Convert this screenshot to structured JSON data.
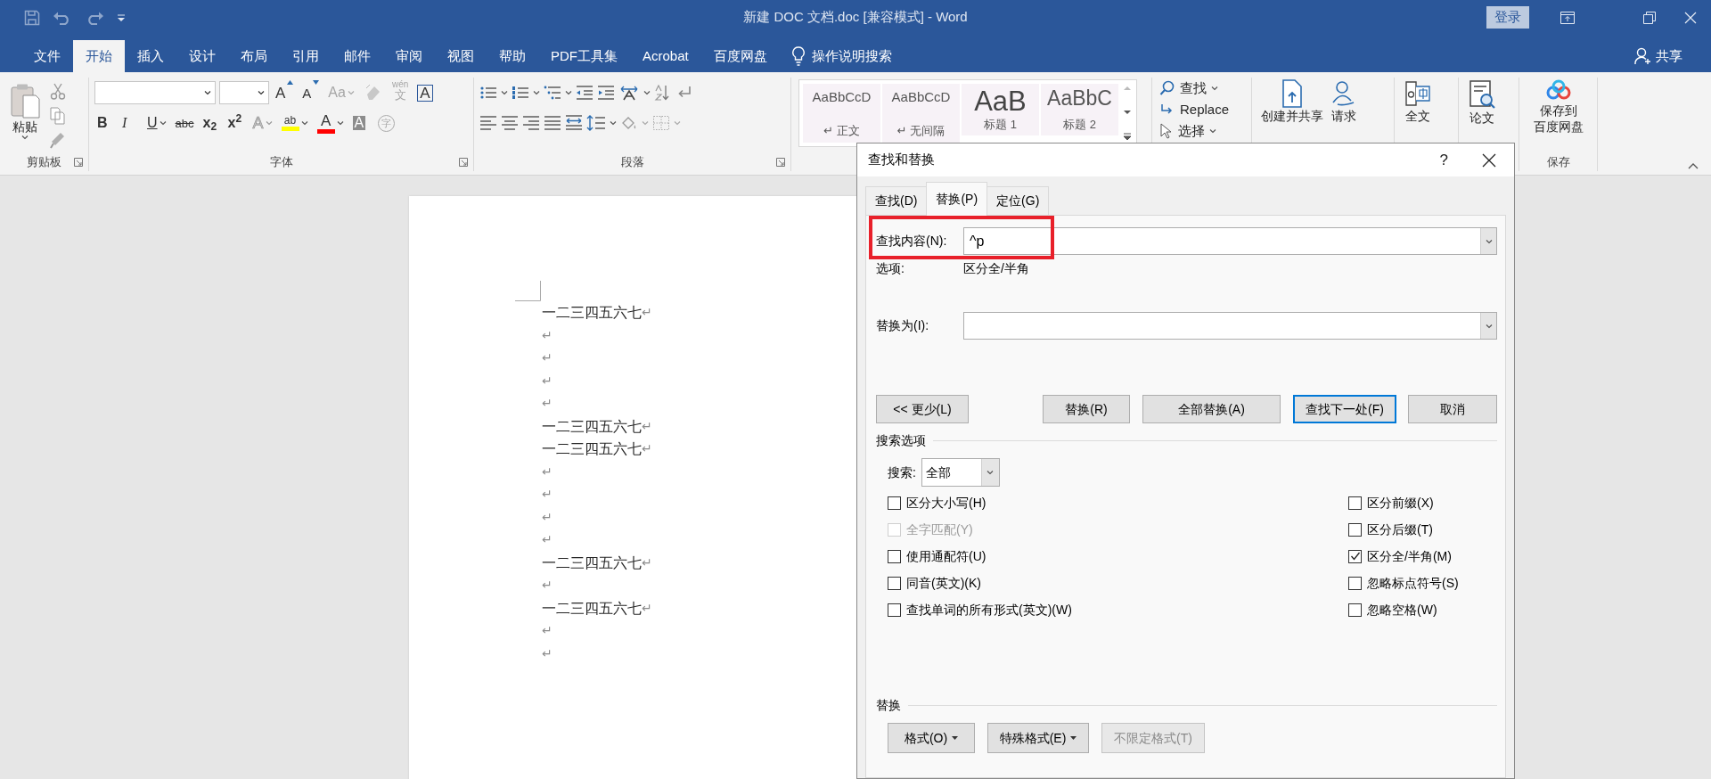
{
  "window": {
    "title": "新建 DOC 文档.doc [兼容模式]  -  Word",
    "sign_in": "登录"
  },
  "tabs": [
    {
      "label": "文件",
      "selected": false
    },
    {
      "label": "开始",
      "selected": true
    },
    {
      "label": "插入",
      "selected": false
    },
    {
      "label": "设计",
      "selected": false
    },
    {
      "label": "布局",
      "selected": false
    },
    {
      "label": "引用",
      "selected": false
    },
    {
      "label": "邮件",
      "selected": false
    },
    {
      "label": "审阅",
      "selected": false
    },
    {
      "label": "视图",
      "selected": false
    },
    {
      "label": "帮助",
      "selected": false
    },
    {
      "label": "PDF工具集",
      "selected": false
    },
    {
      "label": "Acrobat",
      "selected": false
    },
    {
      "label": "百度网盘",
      "selected": false
    }
  ],
  "tell_me": "操作说明搜索",
  "share": "共享",
  "ribbon": {
    "clipboard": {
      "paste": "粘贴",
      "label": "剪贴板"
    },
    "font": {
      "label": "字体",
      "tools_row1": [
        {
          "kind": "grow",
          "glyph": "A",
          "disabled": false
        },
        {
          "kind": "shrink",
          "glyph": "A",
          "disabled": false
        },
        {
          "kind": "case",
          "glyph": "Aa",
          "disabled": true
        },
        {
          "kind": "clear",
          "disabled": true
        },
        {
          "kind": "phonetic",
          "glyph": "文",
          "ruby": "wén",
          "disabled": true
        },
        {
          "kind": "border",
          "glyph": "A",
          "disabled": false
        }
      ],
      "tools_row2": [
        {
          "kind": "bold",
          "glyph": "B",
          "disabled": false
        },
        {
          "kind": "italic",
          "glyph": "I",
          "disabled": false
        },
        {
          "kind": "underline",
          "glyph": "U",
          "disabled": false
        },
        {
          "kind": "strike",
          "glyph": "abc",
          "disabled": false
        },
        {
          "kind": "subscript",
          "glyph": "x$_{2}$",
          "disabled": false
        },
        {
          "kind": "superscript",
          "glyph": "x$^{2}$",
          "disabled": false
        },
        {
          "kind": "effects",
          "glyph": "A",
          "disabled": true
        },
        {
          "kind": "highlight",
          "glyph": "ab",
          "color": "#ffff00",
          "disabled": false
        },
        {
          "kind": "font_color",
          "glyph": "A",
          "color": "#ff0000",
          "disabled": false
        },
        {
          "kind": "shading",
          "glyph": "A",
          "disabled": false
        },
        {
          "kind": "enclose",
          "glyph": "字",
          "disabled": true
        }
      ]
    },
    "paragraph": {
      "label": "段落"
    },
    "styles": [
      {
        "preview": "AaBbCcD",
        "name": "↵ 正文",
        "kind": "body"
      },
      {
        "preview": "AaBbCcD",
        "name": "↵ 无间隔",
        "kind": "body"
      },
      {
        "preview": "AaB",
        "name": "标题 1",
        "kind": "heading1"
      },
      {
        "preview": "AaBbC",
        "name": "标题 2",
        "kind": "heading2"
      }
    ],
    "editing": {
      "find": "查找",
      "replace": "Replace",
      "select": "选择"
    },
    "adobe": {
      "create_share": "创建并共享",
      "request": "请求"
    },
    "translate": "全文",
    "thesis": "论文",
    "baidu": {
      "lines": [
        "保存到",
        "百度网盘"
      ],
      "label": "保存"
    }
  },
  "document": {
    "paragraphs": [
      {
        "text": "一二三四五六七",
        "mark": "↵"
      },
      {
        "mark": "↵"
      },
      {
        "mark": "↵"
      },
      {
        "mark": "↵"
      },
      {
        "mark": "↵"
      },
      {
        "text": "一二三四五六七",
        "mark": "↵"
      },
      {
        "text": "一二三四五六七",
        "mark": "↵"
      },
      {
        "mark": "↵"
      },
      {
        "mark": "↵"
      },
      {
        "mark": "↵"
      },
      {
        "mark": "↵"
      },
      {
        "text": "一二三四五六七",
        "mark": "↵"
      },
      {
        "mark": "↵"
      },
      {
        "text": "一二三四五六七",
        "mark": "↵"
      },
      {
        "mark": "↵"
      },
      {
        "mark": "↵"
      }
    ]
  },
  "dialog": {
    "title": "查找和替换",
    "help": "?",
    "tabs": [
      {
        "label": "查找(D)",
        "selected": false
      },
      {
        "label": "替换(P)",
        "selected": true
      },
      {
        "label": "定位(G)",
        "selected": false
      }
    ],
    "find_label": "查找内容(N):",
    "find_value": "^p",
    "options_label": "选项:",
    "options_value": "区分全/半角",
    "replace_label": "替换为(I):",
    "buttons": [
      {
        "label": "<< 更少(L)",
        "default": false
      },
      {
        "label": "替换(R)",
        "default": false
      },
      {
        "label": "全部替换(A)",
        "default": false
      },
      {
        "label": "查找下一处(F)",
        "default": true
      },
      {
        "label": "取消",
        "default": false
      }
    ],
    "search_options_title": "搜索选项",
    "search_label": "搜索:",
    "search_value": "全部",
    "left_options": [
      {
        "label": "区分大小写(H)",
        "checked": false,
        "disabled": false
      },
      {
        "label": "全字匹配(Y)",
        "checked": false,
        "disabled": true
      },
      {
        "label": "使用通配符(U)",
        "checked": false,
        "disabled": false
      },
      {
        "label": "同音(英文)(K)",
        "checked": false,
        "disabled": false
      },
      {
        "label": "查找单词的所有形式(英文)(W)",
        "checked": false,
        "disabled": false
      }
    ],
    "right_options": [
      {
        "label": "区分前缀(X)",
        "checked": false,
        "disabled": false
      },
      {
        "label": "区分后缀(T)",
        "checked": false,
        "disabled": false
      },
      {
        "label": "区分全/半角(M)",
        "checked": true,
        "disabled": false
      },
      {
        "label": "忽略标点符号(S)",
        "checked": false,
        "disabled": false
      },
      {
        "label": "忽略空格(W)",
        "checked": false,
        "disabled": false
      }
    ],
    "replace_section_title": "替换",
    "format_buttons": [
      {
        "label": "格式(O)",
        "dropdown": true,
        "disabled": false
      },
      {
        "label": "特殊格式(E)",
        "dropdown": true,
        "disabled": false
      },
      {
        "label": "不限定格式(T)",
        "dropdown": false,
        "disabled": true
      }
    ]
  }
}
